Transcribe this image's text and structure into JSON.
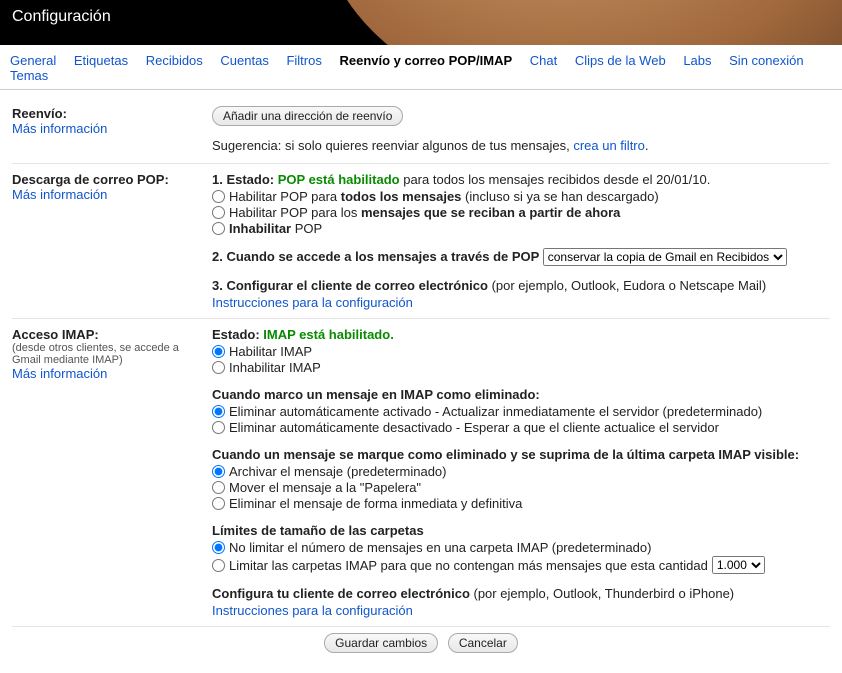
{
  "header": {
    "title": "Configuración"
  },
  "tabs": {
    "general": "General",
    "etiquetas": "Etiquetas",
    "recibidos": "Recibidos",
    "cuentas": "Cuentas",
    "filtros": "Filtros",
    "reenvio": "Reenvío y correo POP/IMAP",
    "chat": "Chat",
    "clips": "Clips de la Web",
    "labs": "Labs",
    "sinconexion": "Sin conexión",
    "temas": "Temas"
  },
  "forwarding": {
    "title": "Reenvío:",
    "more": "Más información",
    "addBtn": "Añadir una dirección de reenvío",
    "hintPre": "Sugerencia: si solo quieres reenviar algunos de tus mensajes, ",
    "hintLink": "crea un filtro",
    "hintPost": "."
  },
  "pop": {
    "title": "Descarga de correo POP:",
    "more": "Más información",
    "statusLabel": "1. Estado: ",
    "statusGreen": "POP está habilitado",
    "statusTail": " para todos los mensajes recibidos desde el 20/01/10.",
    "opt1a": "Habilitar POP para ",
    "opt1b": "todos los mensajes",
    "opt1c": " (incluso si ya se han descargado)",
    "opt2a": "Habilitar POP para los ",
    "opt2b": "mensajes que se reciban a partir de ahora",
    "opt3a": "Inhabilitar",
    "opt3b": " POP",
    "whenAccess": "2. Cuando se accede a los mensajes a través de POP ",
    "selectVal": "conservar la copia de Gmail en Recibidos",
    "configLabel": "3. Configurar el cliente de correo electrónico ",
    "configTail": "(por ejemplo, Outlook, Eudora o Netscape Mail)",
    "configLink": "Instrucciones para la configuración"
  },
  "imap": {
    "title": "Acceso IMAP:",
    "sub": "(desde otros clientes, se accede a Gmail mediante IMAP)",
    "more": "Más información",
    "statusLabel": "Estado: ",
    "statusGreen": "IMAP está habilitado.",
    "enable": "Habilitar IMAP",
    "disable": "Inhabilitar IMAP",
    "markDeleted": "Cuando marco un mensaje en IMAP como eliminado:",
    "md1": "Eliminar automáticamente activado - Actualizar inmediatamente el servidor (predeterminado)",
    "md2": "Eliminar automáticamente desactivado - Esperar a que el cliente actualice el servidor",
    "lastVisible": "Cuando un mensaje se marque como eliminado y se suprima de la última carpeta IMAP visible:",
    "lv1": "Archivar el mensaje (predeterminado)",
    "lv2": "Mover el mensaje a la \"Papelera\"",
    "lv3": "Eliminar el mensaje de forma inmediata y definitiva",
    "sizeLimits": "Límites de tamaño de las carpetas",
    "sl1": "No limitar el número de mensajes en una carpeta IMAP (predeterminado)",
    "sl2": "Limitar las carpetas IMAP para que no contengan más mensajes que esta cantidad ",
    "sl2val": "1.000",
    "configLabel": "Configura tu cliente de correo electrónico ",
    "configTail": "(por ejemplo, Outlook, Thunderbird o iPhone)",
    "configLink": "Instrucciones para la configuración"
  },
  "footer": {
    "save": "Guardar cambios",
    "cancel": "Cancelar"
  }
}
